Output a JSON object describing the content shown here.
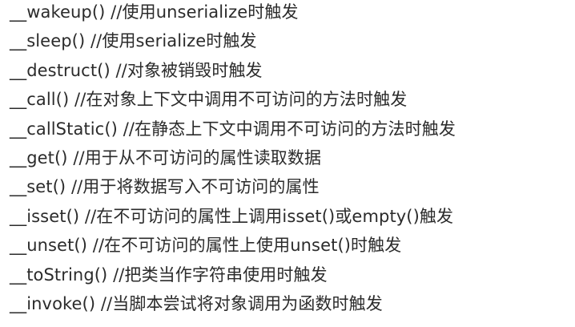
{
  "lines": [
    "__wakeup() //使用unserialize时触发",
    "__sleep() //使用serialize时触发",
    "__destruct() //对象被销毁时触发",
    "__call() //在对象上下文中调用不可访问的方法时触发",
    "__callStatic() //在静态上下文中调用不可访问的方法时触发",
    "__get() //用于从不可访问的属性读取数据",
    "__set() //用于将数据写入不可访问的属性",
    "__isset() //在不可访问的属性上调用isset()或empty()触发",
    "__unset() //在不可访问的属性上使用unset()时触发",
    "__toString() //把类当作字符串使用时触发",
    "__invoke() //当脚本尝试将对象调用为函数时触发"
  ]
}
